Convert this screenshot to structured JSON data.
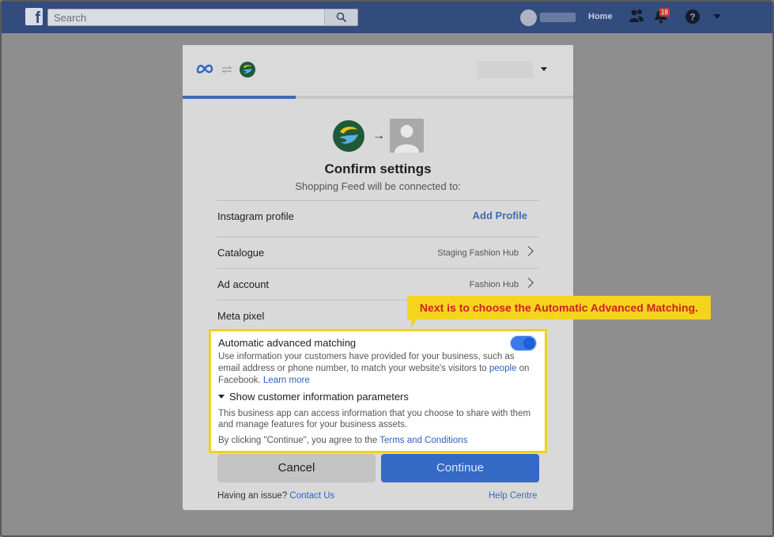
{
  "topbar": {
    "logo": "f",
    "search_placeholder": "Search",
    "home_label": "Home",
    "notification_count": "18"
  },
  "dialog": {
    "title": "Confirm settings",
    "subtitle": "Shopping Feed will be connected to:",
    "rows": [
      {
        "label": "Instagram profile",
        "action": "Add Profile"
      },
      {
        "label": "Catalogue",
        "value": "Staging Fashion Hub"
      },
      {
        "label": "Ad account",
        "value": "Fashion Hub"
      },
      {
        "label": "Meta pixel"
      }
    ],
    "matching": {
      "title": "Automatic advanced matching",
      "desc_part1": "Use information your customers have provided for your business, such as email address or phone number, to match your website's visitors to ",
      "desc_link_people": "people",
      "desc_part2": " on Facebook. ",
      "desc_link_learn": "Learn more",
      "toggle_on": true,
      "show_params": "Show customer information parameters",
      "access_text": "This business app can access information that you choose to share with them and manage features for your business assets.",
      "terms_prefix": "By clicking \"Continue\", you agree to the ",
      "terms_link": "Terms and Conditions"
    },
    "cancel_label": "Cancel",
    "continue_label": "Continue",
    "issue_prefix": "Having an issue? ",
    "contact_link": "Contact Us",
    "help_link": "Help Centre",
    "progress": 0.29
  },
  "callout": {
    "text": "Next is to choose the Automatic Advanced Matching."
  },
  "colors": {
    "topbar": "#334c7e",
    "accent": "#3469c5",
    "highlight_border": "#f0d21b",
    "callout_bg": "#f5d51c",
    "callout_text": "#d22020"
  }
}
